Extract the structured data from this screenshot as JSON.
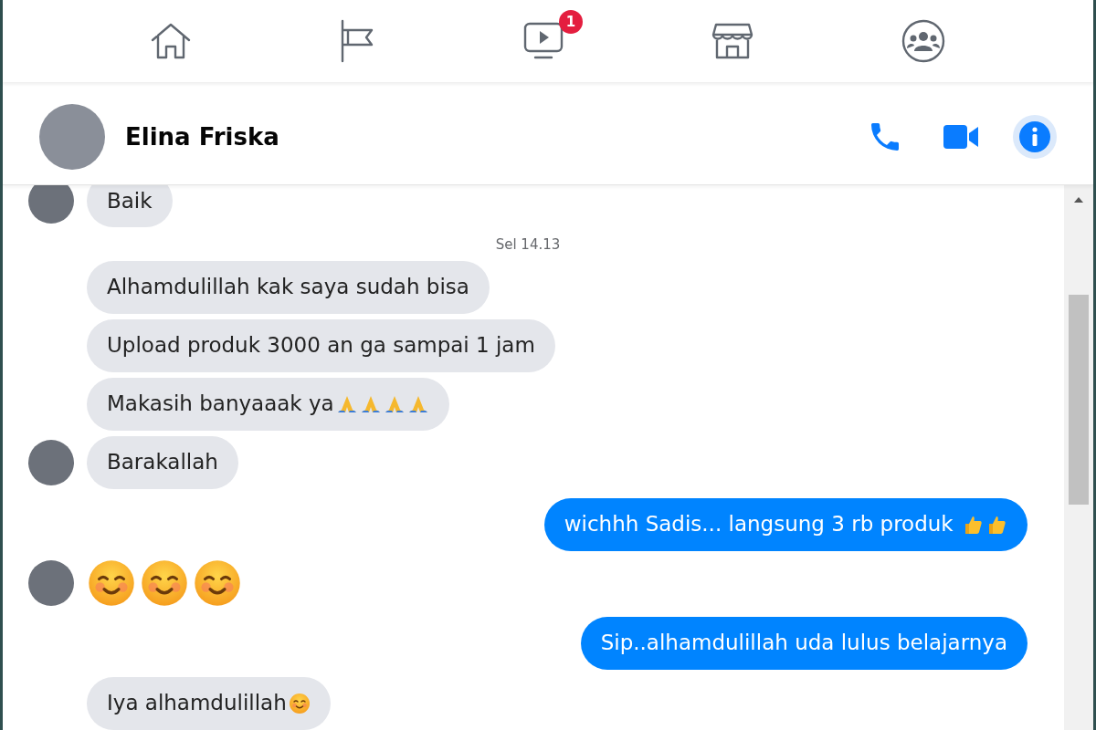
{
  "nav": [
    {
      "kind": "home",
      "selected": false
    },
    {
      "kind": "flag",
      "selected": false
    },
    {
      "kind": "watch",
      "selected": false,
      "badge": "1"
    },
    {
      "kind": "store",
      "selected": false
    },
    {
      "kind": "groups",
      "selected": false
    }
  ],
  "conversation": {
    "name": "Elina Friska",
    "actions": [
      {
        "kind": "phone"
      },
      {
        "kind": "video"
      },
      {
        "kind": "info",
        "selected": true
      }
    ]
  },
  "messages": [
    {
      "kind": "incoming",
      "avatar": true,
      "text": "Baik"
    },
    {
      "kind": "time",
      "text": "Sel 14.13"
    },
    {
      "kind": "incoming",
      "avatar": false,
      "text": "Alhamdulillah kak saya sudah bisa"
    },
    {
      "kind": "incoming",
      "avatar": false,
      "text": "Upload produk 3000 an ga sampai 1 jam"
    },
    {
      "kind": "incoming",
      "avatar": false,
      "text": "Makasih banyaaak ya",
      "emojis": [
        {
          "kind": "pray"
        },
        {
          "kind": "pray"
        },
        {
          "kind": "pray"
        },
        {
          "kind": "pray"
        }
      ]
    },
    {
      "kind": "incoming",
      "avatar": true,
      "text": "Barakallah"
    },
    {
      "kind": "outgoing",
      "text": "wichhh Sadis... langsung 3 rb produk ",
      "emojis": [
        {
          "kind": "thumbs-up"
        },
        {
          "kind": "thumbs-up"
        }
      ]
    },
    {
      "kind": "incoming-emoji",
      "avatar": true,
      "emojis": [
        {
          "kind": "smile"
        },
        {
          "kind": "smile"
        },
        {
          "kind": "smile"
        }
      ]
    },
    {
      "kind": "outgoing",
      "text": "Sip..alhamdulillah uda lulus belajarnya"
    },
    {
      "kind": "incoming",
      "avatar": false,
      "text": "Iya alhamdulillah",
      "emojis": [
        {
          "kind": "smile"
        }
      ]
    }
  ]
}
